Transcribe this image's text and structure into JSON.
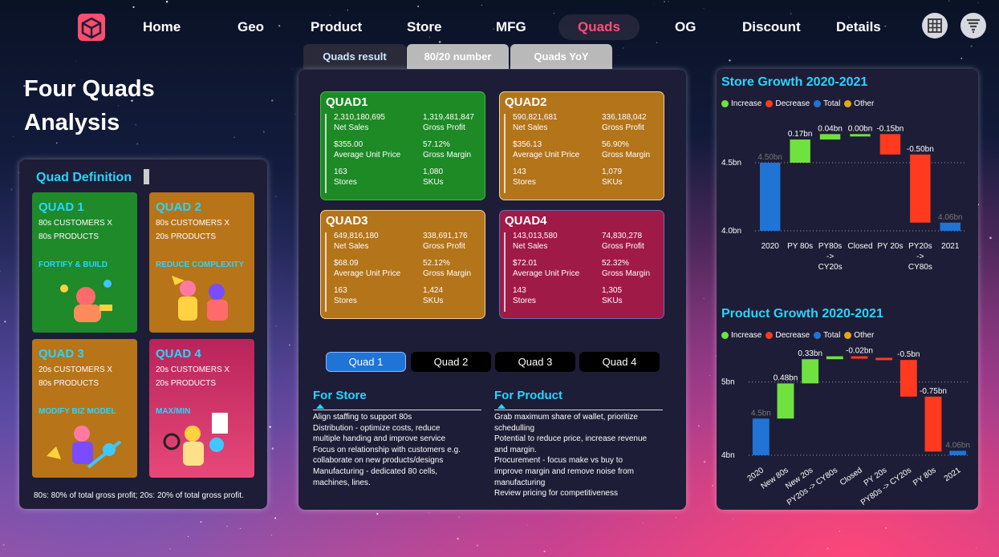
{
  "nav": {
    "items": [
      "Home",
      "Geo",
      "Product",
      "Store",
      "MFG",
      "Quads",
      "OG",
      "Discount",
      "Details"
    ],
    "active": "Quads"
  },
  "page_title": [
    "Four Quads",
    "Analysis"
  ],
  "tabs": [
    "Quads result",
    "80/20 number",
    "Quads YoY"
  ],
  "quad_definition": {
    "title": "Quad Definition",
    "cards": [
      {
        "name": "QUAD 1",
        "line1": "80s CUSTOMERS X",
        "line2": "80s PRODUCTS",
        "action": "FORTIFY & BUILD",
        "color": "#1e8a2a"
      },
      {
        "name": "QUAD 2",
        "line1": "80s CUSTOMERS X",
        "line2": "20s PRODUCTS",
        "action": "REDUCE COMPLEXITY",
        "color": "#b77418"
      },
      {
        "name": "QUAD 3",
        "line1": "20s CUSTOMERS X",
        "line2": "80s PRODUCTS",
        "action": "MODIFY BIZ MODEL",
        "color": "#b77418"
      },
      {
        "name": "QUAD 4",
        "line1": "20s CUSTOMERS X",
        "line2": "20s PRODUCTS",
        "action": "MAX/MIN",
        "color": "#c0295c"
      }
    ],
    "footnote": "80s: 80% of total gross profit; 20s: 20% of total gross profit."
  },
  "quads": [
    {
      "name": "QUAD1",
      "color": "#1d8a25",
      "border": "#3fbf3f",
      "net_sales": "2,310,180,695",
      "gross_profit": "1,319,481,847",
      "avg_price": "$355.00",
      "gross_margin": "57.12%",
      "stores": "163",
      "skus": "1,080"
    },
    {
      "name": "QUAD2",
      "color": "#b3741a",
      "border": "#f2d29a",
      "net_sales": "590,821,681",
      "gross_profit": "336,188,042",
      "avg_price": "$356.13",
      "gross_margin": "56.90%",
      "stores": "143",
      "skus": "1,079"
    },
    {
      "name": "QUAD3",
      "color": "#b3741a",
      "border": "#f2d29a",
      "net_sales": "649,816,180",
      "gross_profit": "338,691,176",
      "avg_price": "$68.09",
      "gross_margin": "52.12%",
      "stores": "163",
      "skus": "1,424"
    },
    {
      "name": "QUAD4",
      "color": "#a01a48",
      "border": "#6b6bb0",
      "net_sales": "143,013,580",
      "gross_profit": "74,830,278",
      "avg_price": "$72.01",
      "gross_margin": "52.32%",
      "stores": "143",
      "skus": "1,305"
    }
  ],
  "labels": {
    "net_sales": "Net Sales",
    "gross_profit": "Gross Profit",
    "avg_price": "Average Unit Price",
    "gross_margin": "Gross Margin",
    "stores": "Stores",
    "skus": "SKUs"
  },
  "quad_buttons": [
    "Quad 1",
    "Quad 2",
    "Quad 3",
    "Quad 4"
  ],
  "for_store": {
    "title": "For Store",
    "lines": [
      "Align staffing to support 80s",
      "Distribution - optimize costs, reduce",
      "multiple handing and improve service",
      "Focus on relationship with customers e.g.",
      "collaborate on new products/designs",
      "Manufacturing - dedicated 80 cells,",
      "machines, lines."
    ]
  },
  "for_product": {
    "title": "For Product",
    "lines": [
      "Grab maximum share of wallet, prioritize",
      "schedulling",
      "Potential to reduce price, increase revenue",
      "and margin.",
      "Procurement - focus make vs buy to",
      "improve margin and remove noise from",
      "manufacturing",
      "Review pricing for competitiveness"
    ]
  },
  "legend": [
    "Increase",
    "Decrease",
    "Total",
    "Other"
  ],
  "colors": {
    "increase": "#6fe23f",
    "decrease": "#ff3a1e",
    "total": "#1f74d6",
    "other": "#e0a81c"
  },
  "chart_data": [
    {
      "type": "bar",
      "subtype": "waterfall",
      "title": "Store Growth 2020-2021",
      "categories": [
        "2020",
        "PY 80s",
        "PY80s -> CY20s",
        "Closed",
        "PY 20s",
        "PY20s -> CY80s",
        "2021"
      ],
      "category_lines": [
        [
          "2020"
        ],
        [
          "PY 80s"
        ],
        [
          "PY80s",
          "->",
          "CY20s"
        ],
        [
          "Closed"
        ],
        [
          "PY 20s"
        ],
        [
          "PY20s",
          "->",
          "CY80s"
        ],
        [
          "2021"
        ]
      ],
      "values": [
        4.5,
        0.17,
        0.04,
        0.0,
        -0.15,
        -0.5,
        4.06
      ],
      "value_labels": [
        "4.50bn",
        "0.17bn",
        "0.04bn",
        "0.00bn",
        "-0.15bn",
        "-0.50bn",
        "4.06bn"
      ],
      "kinds": [
        "total",
        "increase",
        "increase",
        "increase",
        "decrease",
        "decrease",
        "total"
      ],
      "y_ticks": [
        "4.5bn",
        "4.0bn"
      ],
      "ylim": [
        4.0,
        4.8
      ]
    },
    {
      "type": "bar",
      "subtype": "waterfall",
      "title": "Product Growth 2020-2021",
      "categories": [
        "2020",
        "New 80s",
        "New 20s",
        "PY20s -> CY80s",
        "Closed",
        "PY 20s",
        "PY80s -> CY20s",
        "PY 80s",
        "2021"
      ],
      "values": [
        4.5,
        0.48,
        0.33,
        0.04,
        -0.02,
        -0.03,
        -0.5,
        -0.75,
        4.06
      ],
      "value_labels": [
        "4.5bn",
        "0.48bn",
        "0.33bn",
        "",
        "-0.02bn",
        "",
        "-0.5bn",
        "-0.75bn",
        "4.06bn"
      ],
      "kinds": [
        "total",
        "increase",
        "increase",
        "increase",
        "decrease",
        "decrease",
        "decrease",
        "decrease",
        "total"
      ],
      "y_ticks": [
        "5bn",
        "4bn"
      ],
      "ylim": [
        4.0,
        5.4
      ]
    }
  ]
}
